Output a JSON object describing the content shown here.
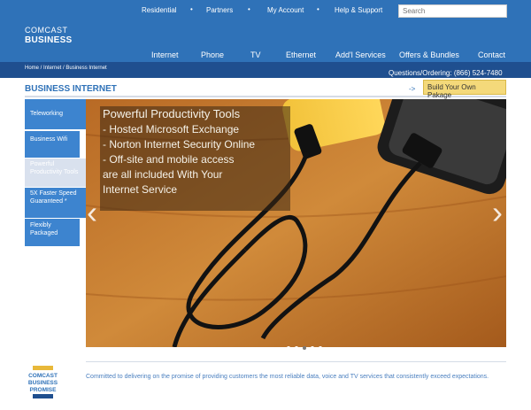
{
  "util_nav": [
    "Residential",
    "Partners",
    "My Account",
    "Help & Support"
  ],
  "search": {
    "placeholder": "Search"
  },
  "logo": {
    "line1": "COMCAST",
    "line2": "BUSINESS"
  },
  "main_nav": [
    "Internet",
    "Phone",
    "TV",
    "Ethernet",
    "Add'l Services",
    "Offers & Bundles",
    "Contact"
  ],
  "breadcrumb": "Home / Internet / Business Internet",
  "phone": "Questions/Ordering: (866) 524-7480",
  "section_title": "BUSINESS INTERNET",
  "build": {
    "arrow": "->",
    "label": "Build Your Own Pakage"
  },
  "sidebar": [
    {
      "label": "Teleworking"
    },
    {
      "label": "Business Wifi"
    },
    {
      "label": "Powerful Productivity Tools"
    },
    {
      "label": "5X Faster Speed Guaranteed *"
    },
    {
      "label": "Flexibly Packaged"
    }
  ],
  "hero": {
    "title": "Powerful Productivity Tools",
    "lines": [
      "- Hosted Microsoft Exchange",
      "- Norton Internet Security Online",
      "- Off-site and mobile access",
      "are all included With Your",
      "Internet Service"
    ],
    "prev_icon": "chevron-left-icon",
    "next_icon": "chevron-right-icon",
    "slides": 5,
    "current_slide": 3
  },
  "badge": {
    "line1": "COMCAST",
    "line2": "BUSINESS",
    "line3": "PROMISE"
  },
  "promise": "Committed to delivering on the promise of providing customers the most reliable data, voice and TV services that consistently exceed expectations.",
  "colors": {
    "header": "#2f72b8",
    "crumbbar": "#1f4f8f",
    "accent": "#f4d97a",
    "sidebar": "#3d84cf"
  }
}
